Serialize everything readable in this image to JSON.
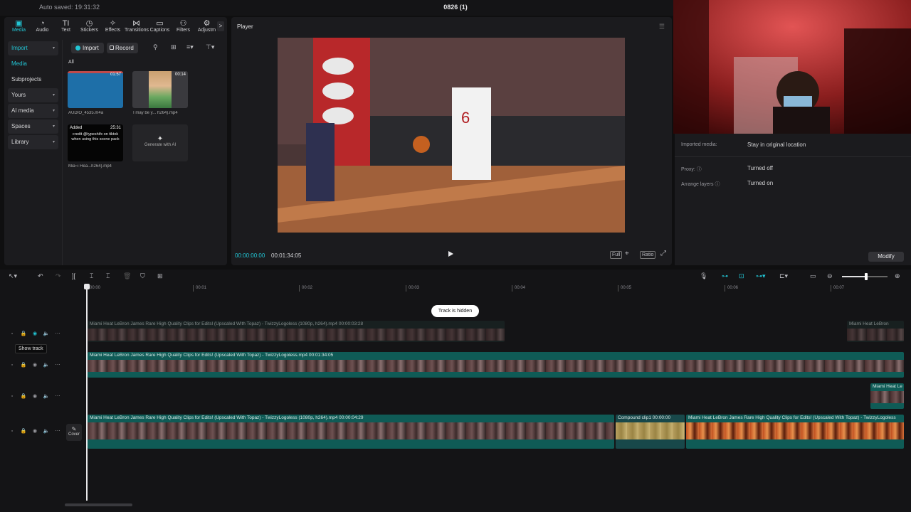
{
  "titlebar": {
    "autosave": "Auto saved: 19:31:32",
    "project": "0826 (1)"
  },
  "toolbar": {
    "tools": [
      {
        "label": "Media",
        "icon": "media-icon",
        "glyph": "▣"
      },
      {
        "label": "Audio",
        "icon": "audio-icon",
        "glyph": "◔"
      },
      {
        "label": "Text",
        "icon": "text-icon",
        "glyph": "TI"
      },
      {
        "label": "Stickers",
        "icon": "stickers-icon",
        "glyph": "◷"
      },
      {
        "label": "Effects",
        "icon": "effects-icon",
        "glyph": "✧"
      },
      {
        "label": "Transitions",
        "icon": "transitions-icon",
        "glyph": "⋈"
      },
      {
        "label": "Captions",
        "icon": "captions-icon",
        "glyph": "▭"
      },
      {
        "label": "Filters",
        "icon": "filters-icon",
        "glyph": "⚇"
      },
      {
        "label": "Adjustm",
        "icon": "adjustment-icon",
        "glyph": "⚙"
      }
    ],
    "more": ">"
  },
  "sidebar": {
    "items": [
      {
        "label": "Import",
        "caret": "▾"
      },
      {
        "label": "Media",
        "caret": ""
      },
      {
        "label": "Subprojects",
        "caret": ""
      },
      {
        "label": "Yours",
        "caret": "▾"
      },
      {
        "label": "AI media",
        "caret": "▾"
      },
      {
        "label": "Spaces",
        "caret": "▾"
      },
      {
        "label": "Library",
        "caret": "▾"
      }
    ]
  },
  "media": {
    "import_label": "Import",
    "record_label": "Record",
    "filter_label": "All",
    "items": [
      {
        "name": "AUDIO_4535.m4a",
        "duration": "01:57"
      },
      {
        "name": "I may be y... h264).mp4",
        "duration": "00:14"
      },
      {
        "name": "Mia~i Hea...h264).mp4",
        "duration": "25:31",
        "badge": "Added",
        "caption": "credit @typeshifx on tiktok when using this scene pack"
      }
    ],
    "generate_label": "Generate with AI"
  },
  "player": {
    "title": "Player",
    "time_current": "00:00:00:00",
    "time_total": "00:01:34:05",
    "controls": [
      "Full",
      "Ratio"
    ]
  },
  "details": {
    "rows": [
      {
        "label": "Imported media:",
        "value": "Stay in original location"
      },
      {
        "label": "Proxy: ⓘ",
        "value": "Turned off"
      },
      {
        "label": "Arrange layers ⓘ",
        "value": "Turned on"
      }
    ],
    "modify_label": "Modify"
  },
  "timeline": {
    "ruler": [
      "00:00",
      "00:01",
      "00:02",
      "00:03",
      "00:04",
      "00:05",
      "00:06",
      "00:07"
    ],
    "hidden_notice": "Track is hidden",
    "tooltip": "Show track",
    "cover_label": "Cover",
    "clips": {
      "c1_label": "Miami Heat LeBron James Rare High Quality Clips for Editsl (Upscaled With Topaz) - TwizzyLogoless (1080p, h264).mp4   00:00:03:28",
      "c1b_label": "Miami Heat LeBron",
      "c2_label": "Miami Heat LeBron James Rare High Quality Clips for Edits! (Upscaled With Topaz) - TwizzyLogoless.mp4   00:01:34:05",
      "c3_label": "Miami Heat Le",
      "c4_label": "Miami Heat LeBron James Rare High Quality Clips for Edits! (Upscaled With Topaz) - TwizzyLogoless (1080p, h264).mp4   00:00:04:29",
      "c5_label": "Compound clip1  00:00:00",
      "c6_label": "Miami Heat LeBron James Rare High Quality Clips for Edits! (Upscaled With Topaz) - TwizzyLogoless"
    }
  },
  "colors": {
    "accent": "#22c5d4",
    "clip": "#0f5b56",
    "panel": "#1b1b1e"
  }
}
